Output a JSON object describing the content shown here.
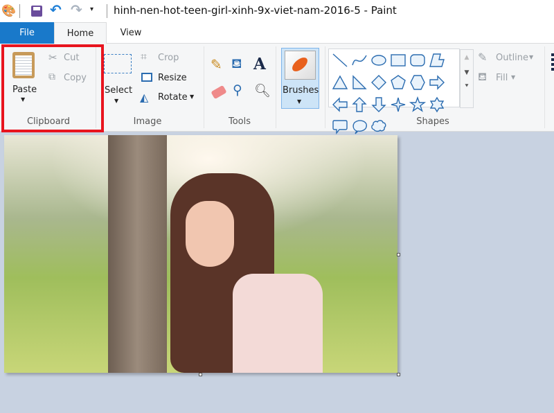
{
  "window": {
    "title": "hinh-nen-hot-teen-girl-xinh-9x-viet-nam-2016-5 - Paint"
  },
  "quick_access": {
    "icons": [
      "paint-app-icon",
      "save-icon",
      "undo-icon",
      "redo-icon",
      "customize-dropdown-icon"
    ]
  },
  "tabs": [
    {
      "label": "File"
    },
    {
      "label": "Home"
    },
    {
      "label": "View"
    }
  ],
  "ribbon": {
    "clipboard": {
      "label": "Clipboard",
      "paste": "Paste",
      "cut": "Cut",
      "copy": "Copy"
    },
    "image": {
      "label": "Image",
      "select": "Select",
      "crop": "Crop",
      "resize": "Resize",
      "rotate": "Rotate"
    },
    "tools": {
      "label": "Tools"
    },
    "brushes": {
      "label": "Brushes"
    },
    "shapes": {
      "label": "Shapes",
      "outline": "Outline",
      "fill": "Fill",
      "items": [
        "line",
        "curve",
        "oval",
        "rectangle",
        "rounded-rectangle",
        "polygon",
        "triangle",
        "right-triangle",
        "diamond",
        "pentagon",
        "hexagon",
        "right-arrow",
        "left-arrow",
        "up-arrow",
        "down-arrow",
        "four-point-star",
        "five-point-star",
        "six-point-star",
        "rounded-rectangular-callout",
        "oval-callout",
        "cloud-callout"
      ]
    }
  },
  "colors": {
    "file_tab": "#1979ca",
    "highlight_box": "#e8141e",
    "shape_stroke": "#2b6cb0",
    "canvas_bg": "#c8d2e1"
  }
}
